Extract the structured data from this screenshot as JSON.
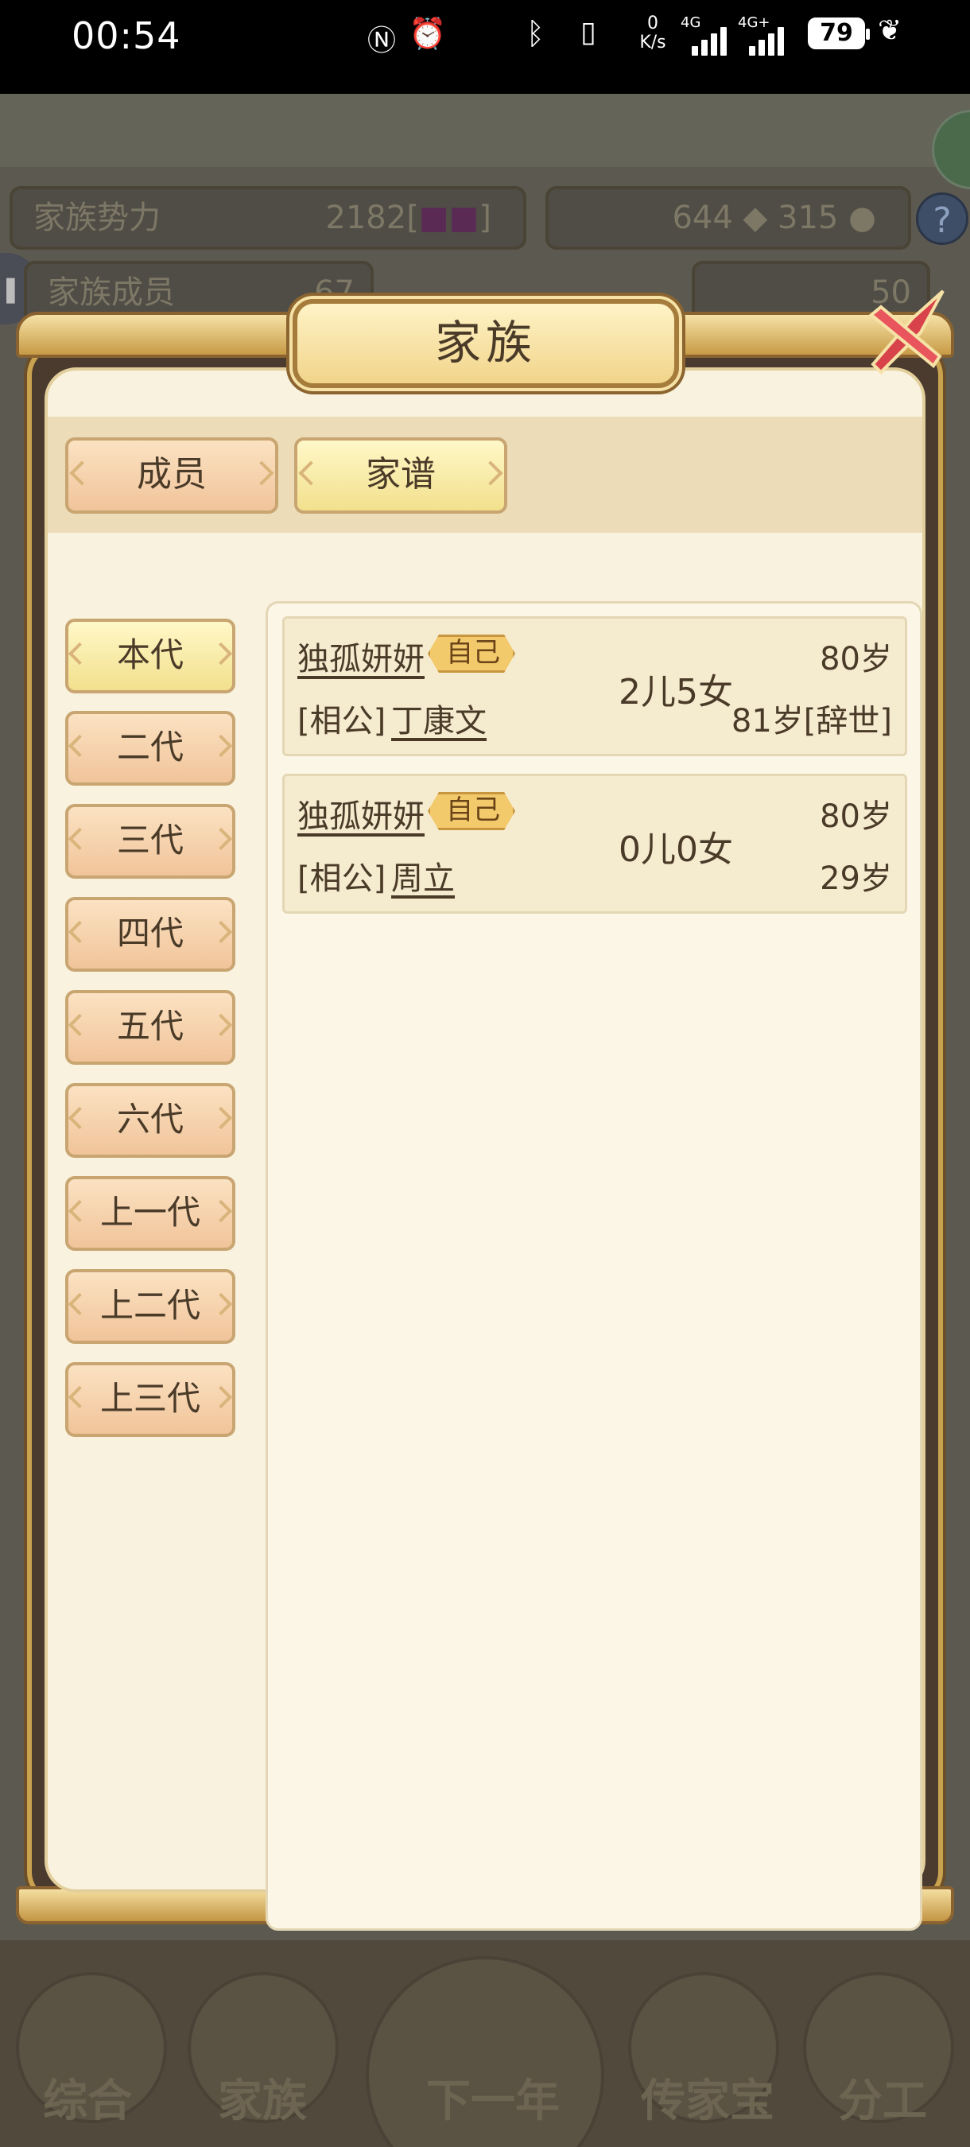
{
  "status_bar": {
    "time": "00:54",
    "net_speed_value": "0",
    "net_speed_unit": "K/s",
    "signal1_label": "4G",
    "signal2_label": "4G+",
    "battery": "79"
  },
  "background": {
    "stat_power_label": "家族势力",
    "stat_power_value": "2182",
    "stat_members_label": "家族成员",
    "stat_members_value": "67",
    "resource_value": "644",
    "resource2_value": "315",
    "gold_value": "50",
    "nav": [
      "综合",
      "家族",
      "下一年",
      "传家宝",
      "分工"
    ]
  },
  "modal": {
    "title": "家族",
    "tabs": [
      {
        "label": "成员",
        "active": false
      },
      {
        "label": "家谱",
        "active": true
      }
    ],
    "generations": [
      {
        "label": "本代",
        "active": true
      },
      {
        "label": "二代",
        "active": false
      },
      {
        "label": "三代",
        "active": false
      },
      {
        "label": "四代",
        "active": false
      },
      {
        "label": "五代",
        "active": false
      },
      {
        "label": "六代",
        "active": false
      },
      {
        "label": "上一代",
        "active": false
      },
      {
        "label": "上二代",
        "active": false
      },
      {
        "label": "上三代",
        "active": false
      }
    ],
    "members": [
      {
        "name": "独孤妍妍",
        "badge": "自己",
        "spouse_label": "[相公]",
        "spouse_name": "丁康文",
        "children": "2儿5女",
        "age": "80岁",
        "spouse_age": "81岁[辞世]"
      },
      {
        "name": "独孤妍妍",
        "badge": "自己",
        "spouse_label": "[相公]",
        "spouse_name": "周立",
        "children": "0儿0女",
        "age": "80岁",
        "spouse_age": "29岁"
      }
    ]
  },
  "colors": {
    "panel_bg": "#f8f2df",
    "tab_active": "#f2e08d",
    "tab_inactive": "#f1c49a",
    "frame_gold": "#c9a24f",
    "close_red": "#d8424a"
  }
}
